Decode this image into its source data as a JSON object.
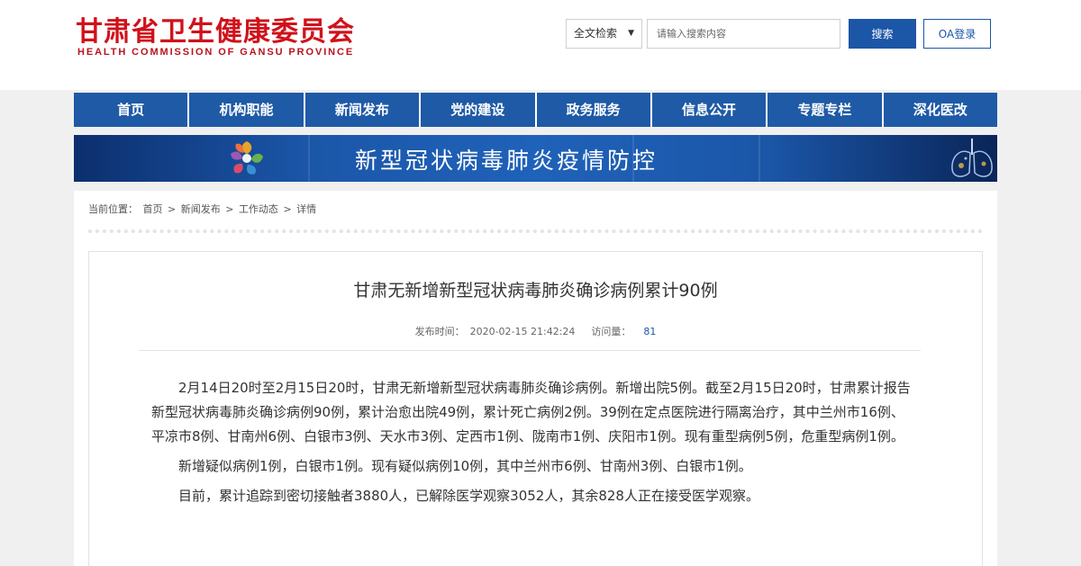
{
  "header": {
    "logo_cn": "甘肃省卫生健康委员会",
    "logo_en": "HEALTH COMMISSION OF GANSU PROVINCE",
    "search_scope": "全文检索",
    "search_placeholder": "请输入搜索内容",
    "search_button": "搜索",
    "oa_button": "OA登录"
  },
  "nav": {
    "items": [
      "首页",
      "机构职能",
      "新闻发布",
      "党的建设",
      "政务服务",
      "信息公开",
      "专题专栏",
      "深化医改"
    ]
  },
  "banner": {
    "text": "新型冠状病毒肺炎疫情防控"
  },
  "breadcrumb": {
    "label": "当前位置：",
    "items": [
      "首页",
      "新闻发布",
      "工作动态",
      "详情"
    ],
    "separator": ">"
  },
  "article": {
    "title": "甘肃无新增新型冠状病毒肺炎确诊病例累计90例",
    "publish_label": "发布时间：",
    "publish_time": "2020-02-15 21:42:24",
    "views_label": "访问量：",
    "views": "81",
    "paragraphs": [
      "2月14日20时至2月15日20时，甘肃无新增新型冠状病毒肺炎确诊病例。新增出院5例。截至2月15日20时，甘肃累计报告新型冠状病毒肺炎确诊病例90例，累计治愈出院49例，累计死亡病例2例。39例在定点医院进行隔离治疗，其中兰州市16例、平凉市8例、甘南州6例、白银市3例、天水市3例、定西市1例、陇南市1例、庆阳市1例。现有重型病例5例，危重型病例1例。",
      "新增疑似病例1例，白银市1例。现有疑似病例10例，其中兰州市6例、甘南州3例、白银市1例。",
      "目前，累计追踪到密切接触者3880人，已解除医学观察3052人，其余828人正在接受医学观察。"
    ]
  },
  "colors": {
    "brand_red": "#d0121b",
    "nav_blue": "#1f5aa6",
    "button_blue": "#1c56a6"
  },
  "icons": {
    "banner_left": "flower-logo-icon",
    "banner_right": "lungs-icon",
    "select": "caret-down-icon"
  }
}
